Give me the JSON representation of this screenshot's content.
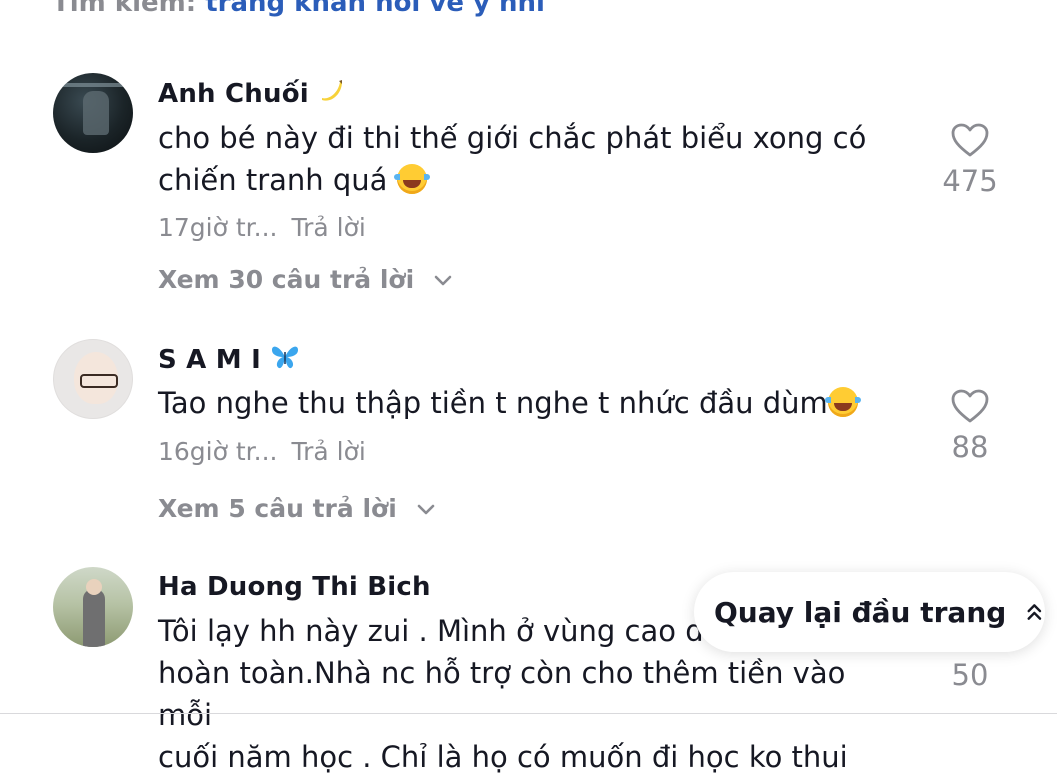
{
  "search": {
    "label": "Tìm kiếm:",
    "query": "trang khán hỏi về ý nhi"
  },
  "comments": [
    {
      "username": "Anh Chuối",
      "avatar_icon": "avatar-man-dark",
      "text_line1": "cho bé này đi thi thế giới chắc phát biểu xong có",
      "text_line2": "chiến tranh quá",
      "time": "17giờ tr...",
      "reply_label": "Trả lời",
      "likes": "475",
      "view_replies": "Xem 30 câu trả lời"
    },
    {
      "username": "S A M I",
      "avatar_icon": "avatar-woman-glasses",
      "text_line1": "Tao nghe thu thập tiền t nghe t nhức đầu dùm",
      "time": "16giờ tr...",
      "reply_label": "Trả lời",
      "likes": "88",
      "view_replies": "Xem 5 câu trả lời"
    },
    {
      "username": "Ha Duong Thi Bich",
      "avatar_icon": "avatar-woman-field",
      "text_line1": "Tôi lạy hh này zui . Mình ở vùng cao dc",
      "text_line2": "hoàn toàn.Nhà nc hỗ trợ còn cho thêm tiền vào mỗi",
      "text_line3": "cuối năm học . Chỉ là họ có muốn đi học ko thui",
      "likes": "50"
    }
  ],
  "back_to_top": {
    "label": "Quay lại đầu trang"
  },
  "colors": {
    "text": "#161823",
    "muted": "#8a8b91",
    "link": "#2b5db9",
    "emoji": "#ffcc33"
  }
}
